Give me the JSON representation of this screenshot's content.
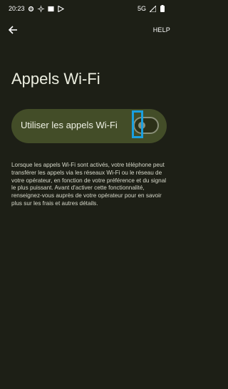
{
  "status_bar": {
    "time": "20:23",
    "network": "5G",
    "left_icons": [
      "gear-icon",
      "brightness-icon",
      "image-icon",
      "play-store-icon"
    ],
    "right_icons": [
      "signal-icon",
      "battery-icon"
    ]
  },
  "app_bar": {
    "back_icon": "arrow-left-icon",
    "help_label": "HELP"
  },
  "page": {
    "title": "Appels Wi-Fi"
  },
  "wifi_toggle": {
    "label": "Utiliser les appels Wi-Fi",
    "enabled": false
  },
  "description": "Lorsque les appels Wi-Fi sont activés, votre téléphone peut transférer les appels via les réseaux Wi-Fi ou le réseau de votre opérateur, en fonction de votre préférence et du signal le plus puissant. Avant d'activer cette fonctionnalité, renseignez-vous auprès de votre opérateur pour en savoir plus sur les frais et autres détails.",
  "colors": {
    "background": "#1d1f16",
    "card": "#434d28",
    "highlight": "#1aa0e0"
  }
}
